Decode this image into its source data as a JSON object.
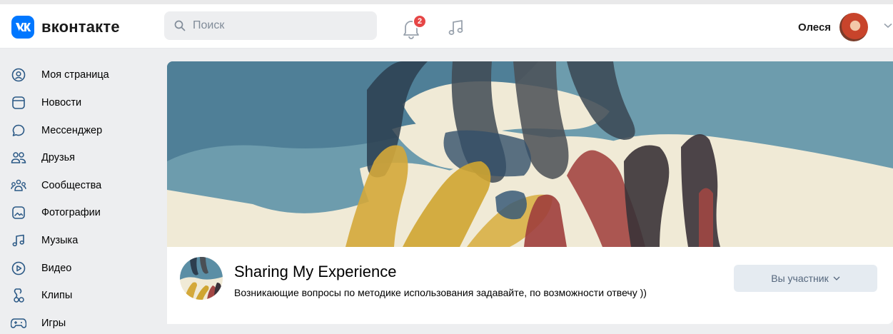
{
  "header": {
    "logo_text": "вконтакте",
    "logo_mark": "vk",
    "search_placeholder": "Поиск",
    "notifications_count": "2",
    "user_name": "Олеся"
  },
  "sidebar": {
    "items": [
      {
        "label": "Моя страница",
        "icon": "profile-icon"
      },
      {
        "label": "Новости",
        "icon": "news-icon"
      },
      {
        "label": "Мессенджер",
        "icon": "messenger-icon"
      },
      {
        "label": "Друзья",
        "icon": "friends-icon"
      },
      {
        "label": "Сообщества",
        "icon": "communities-icon"
      },
      {
        "label": "Фотографии",
        "icon": "photos-icon"
      },
      {
        "label": "Музыка",
        "icon": "music-icon"
      },
      {
        "label": "Видео",
        "icon": "video-icon"
      },
      {
        "label": "Клипы",
        "icon": "clips-icon"
      },
      {
        "label": "Игры",
        "icon": "games-icon"
      }
    ]
  },
  "group": {
    "name": "Sharing My Experience",
    "description": "Возникающие вопросы по методике использования задавайте, по возможности отвечу ))",
    "member_button": "Вы участник"
  },
  "colors": {
    "accent": "#0077ff",
    "icon": "#2a5885",
    "badge": "#e64646"
  }
}
